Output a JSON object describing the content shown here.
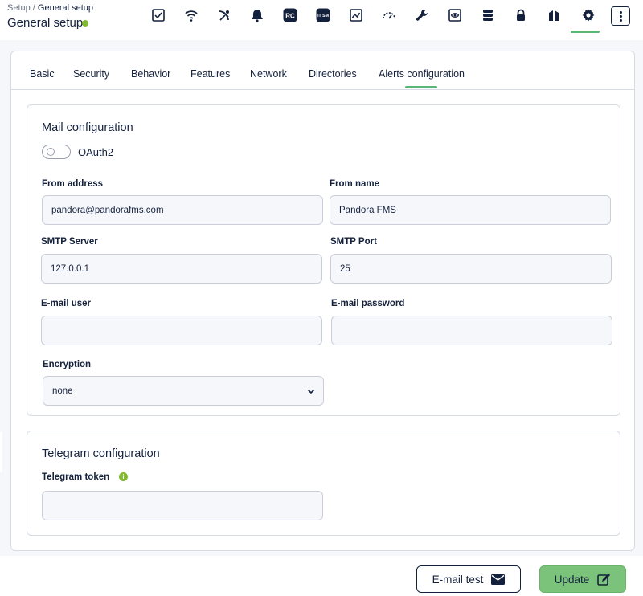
{
  "header": {
    "breadcrumb_parent": "Setup",
    "breadcrumb_sep": " / ",
    "breadcrumb_current": "General setup",
    "title": "General setup",
    "icons": [
      "tasks-icon",
      "wireless-icon",
      "sattelite-icon",
      "bell-icon",
      "rc-icon",
      "itsm-icon",
      "chart-icon",
      "gauge-icon",
      "wrench-icon",
      "eye-icon",
      "database-icon",
      "lock-icon",
      "pillars-icon",
      "gear-icon"
    ],
    "rc_label": "RC",
    "itsm_label": "IT SM",
    "accent_color": "#5bb776"
  },
  "tabs": [
    "Basic",
    "Security",
    "Behavior",
    "Features",
    "Network",
    "Directories",
    "Alerts configuration"
  ],
  "active_tab": "Alerts configuration",
  "mail": {
    "title": "Mail configuration",
    "oauth_label": "OAuth2",
    "oauth_enabled": false,
    "from_address_label": "From address",
    "from_address_value": "pandora@pandorafms.com",
    "from_name_label": "From name",
    "from_name_value": "Pandora FMS",
    "smtp_server_label": "SMTP Server",
    "smtp_server_value": "127.0.0.1",
    "smtp_port_label": "SMTP Port",
    "smtp_port_value": "25",
    "email_user_label": "E-mail user",
    "email_user_value": "",
    "email_password_label": "E-mail password",
    "email_password_value": "",
    "encryption_label": "Encryption",
    "encryption_value": "none"
  },
  "telegram": {
    "title": "Telegram configuration",
    "token_label": "Telegram token",
    "token_value": ""
  },
  "footer": {
    "email_test_label": "E-mail test",
    "update_label": "Update"
  }
}
